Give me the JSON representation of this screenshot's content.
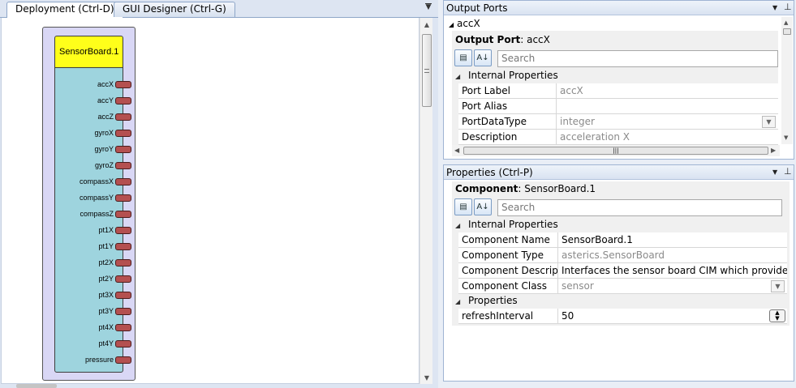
{
  "tabs": [
    {
      "label": "Deployment (Ctrl-D)",
      "active": true
    },
    {
      "label": "GUI Designer (Ctrl-G)",
      "active": false
    }
  ],
  "component": {
    "title": "SensorBoard.1",
    "header_color": "#ffff1a",
    "body_color": "#9ed4de",
    "frame_color": "#d9d7f5",
    "port_color": "#b45050",
    "ports": [
      "accX",
      "accY",
      "accZ",
      "gyroX",
      "gyroY",
      "gyroZ",
      "compassX",
      "compassY",
      "compassZ",
      "pt1X",
      "pt1Y",
      "pt2X",
      "pt2Y",
      "pt3X",
      "pt3Y",
      "pt4X",
      "pt4Y",
      "pressure"
    ]
  },
  "output_ports": {
    "title": "Output Ports",
    "selected_port": "accX",
    "header_label": "Output Port",
    "header_value": "accX",
    "search_placeholder": "Search",
    "category": "Internal Properties",
    "rows": [
      {
        "name": "Port Label",
        "value": "accX"
      },
      {
        "name": "Port Alias",
        "value": ""
      },
      {
        "name": "PortDataType",
        "value": "integer"
      },
      {
        "name": "Description",
        "value": "acceleration X"
      }
    ]
  },
  "properties": {
    "title": "Properties (Ctrl-P)",
    "header_label": "Component",
    "header_value": "SensorBoard.1",
    "search_placeholder": "Search",
    "category_internal": "Internal Properties",
    "internal_rows": [
      {
        "name": "Component Name",
        "value": "SensorBoard.1"
      },
      {
        "name": "Component Type",
        "value": "asterics.SensorBoard"
      },
      {
        "name": "Component Descriptio",
        "value": "Interfaces the sensor board CIM which provides acce"
      },
      {
        "name": "Component Class",
        "value": "sensor"
      }
    ],
    "category_props": "Properties",
    "prop_rows": [
      {
        "name": "refreshInterval",
        "value": "50"
      }
    ]
  },
  "icons": {
    "tab_dropdown": "dropdown-arrow-icon",
    "panel_menu": "panel-menu-icon",
    "pin": "pin-icon",
    "categorized": "categorized-sort-icon",
    "alphabetical": "alphabetical-sort-icon"
  }
}
